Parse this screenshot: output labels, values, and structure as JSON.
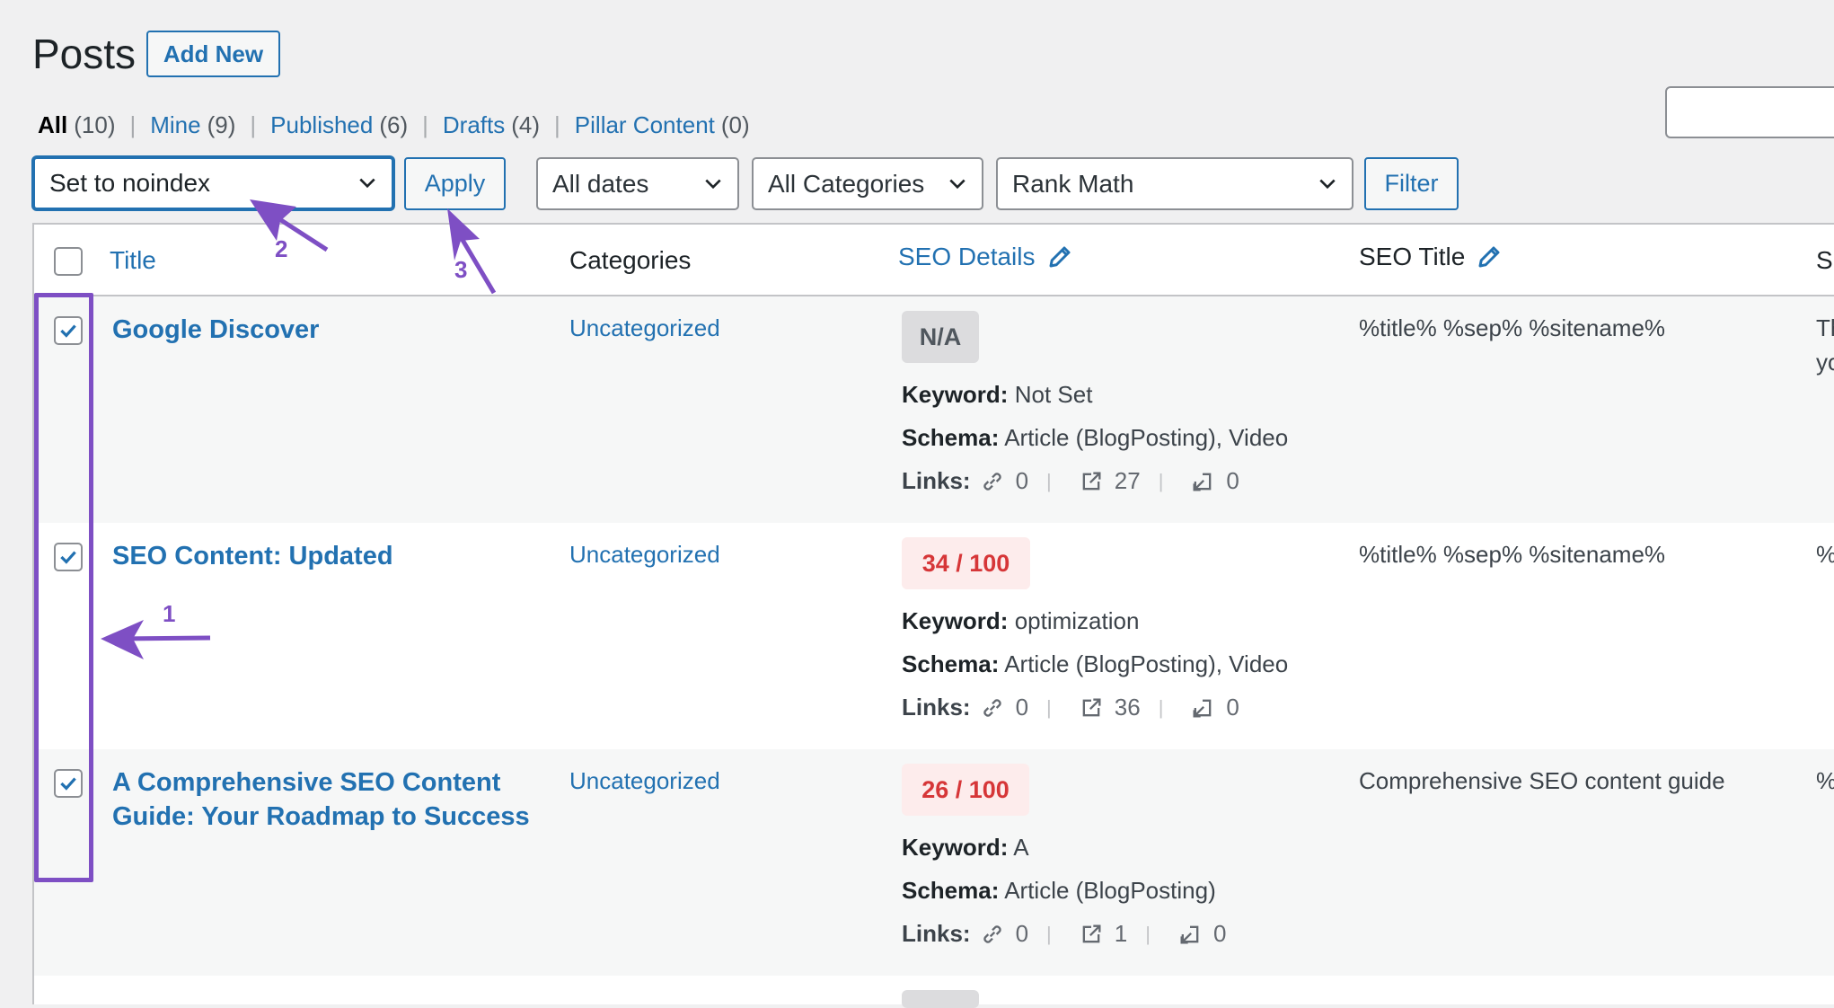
{
  "page": {
    "title": "Posts",
    "add_new_label": "Add New"
  },
  "views": [
    {
      "label": "All",
      "count": "(10)",
      "current": true
    },
    {
      "label": "Mine",
      "count": "(9)"
    },
    {
      "label": "Published",
      "count": "(6)"
    },
    {
      "label": "Drafts",
      "count": "(4)"
    },
    {
      "label": "Pillar Content",
      "count": "(0)"
    }
  ],
  "toolbar": {
    "bulk_action_selected": "Set to noindex",
    "apply_label": "Apply",
    "dates_selected": "All dates",
    "categories_selected": "All Categories",
    "rankmath_selected": "Rank Math",
    "filter_label": "Filter"
  },
  "columns": {
    "title": "Title",
    "categories": "Categories",
    "seo_details": "SEO Details",
    "seo_title": "SEO Title",
    "clipped": "S"
  },
  "rows": [
    {
      "title": "Google Discover",
      "category": "Uncategorized",
      "score": "N/A",
      "keyword": "Not Set",
      "schema": "Article (BlogPosting), Video",
      "internal_links": "0",
      "external_links": "27",
      "incoming_links": "0",
      "seo_title": "%title% %sep% %sitename%",
      "clipped_line1": "Th",
      "clipped_line2": "yo",
      "checked": true
    },
    {
      "title": "SEO Content: Updated",
      "category": "Uncategorized",
      "score": "34 / 100",
      "keyword": "optimization",
      "schema": "Article (BlogPosting), Video",
      "internal_links": "0",
      "external_links": "36",
      "incoming_links": "0",
      "seo_title": "%title% %sep% %sitename%",
      "clipped_line1": "%",
      "checked": true
    },
    {
      "title": "A Comprehensive SEO Content Guide: Your Roadmap to Success",
      "category": "Uncategorized",
      "score": "26 / 100",
      "keyword": "A",
      "schema": "Article (BlogPosting)",
      "internal_links": "0",
      "external_links": "1",
      "incoming_links": "0",
      "seo_title": "Comprehensive SEO content guide",
      "clipped_line1": "%",
      "checked": true
    }
  ],
  "labels": {
    "keyword": "Keyword:",
    "schema": "Schema:",
    "links": "Links:"
  },
  "annotations": {
    "step1": "1",
    "step2": "2",
    "step3": "3"
  },
  "colors": {
    "accent": "#2271b1",
    "annotation": "#7e4fc4",
    "score_bad_bg": "#fdecec",
    "score_bad_text": "#d63638",
    "na_bg": "#dcdcde"
  }
}
